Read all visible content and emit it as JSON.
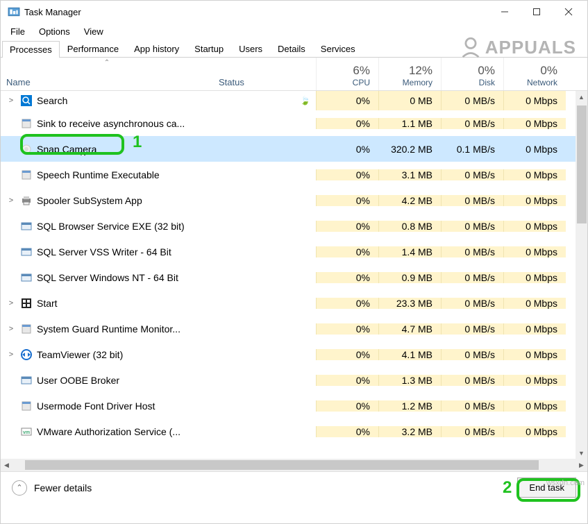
{
  "window": {
    "title": "Task Manager"
  },
  "menu": {
    "file": "File",
    "options": "Options",
    "view": "View"
  },
  "tabs": {
    "processes": "Processes",
    "performance": "Performance",
    "apphistory": "App history",
    "startup": "Startup",
    "users": "Users",
    "details": "Details",
    "services": "Services"
  },
  "watermark": "APPUALS",
  "columns": {
    "name": "Name",
    "status": "Status",
    "cpu_pct": "6%",
    "cpu": "CPU",
    "mem_pct": "12%",
    "mem": "Memory",
    "disk_pct": "0%",
    "disk": "Disk",
    "net_pct": "0%",
    "net": "Network"
  },
  "rows": [
    {
      "expand": ">",
      "icon": "search",
      "name": "Search",
      "status": "leaf",
      "cpu": "0%",
      "mem": "0 MB",
      "disk": "0 MB/s",
      "net": "0 Mbps",
      "top": true
    },
    {
      "expand": "",
      "icon": "generic",
      "name": "Sink to receive asynchronous ca...",
      "status": "",
      "cpu": "0%",
      "mem": "1.1 MB",
      "disk": "0 MB/s",
      "net": "0 Mbps"
    },
    {
      "expand": "",
      "icon": "snap",
      "name": "Snap Camera",
      "status": "",
      "cpu": "0%",
      "mem": "320.2 MB",
      "disk": "0.1 MB/s",
      "net": "0 Mbps",
      "selected": true
    },
    {
      "expand": "",
      "icon": "generic",
      "name": "Speech Runtime Executable",
      "status": "",
      "cpu": "0%",
      "mem": "3.1 MB",
      "disk": "0 MB/s",
      "net": "0 Mbps"
    },
    {
      "expand": ">",
      "icon": "printer",
      "name": "Spooler SubSystem App",
      "status": "",
      "cpu": "0%",
      "mem": "4.2 MB",
      "disk": "0 MB/s",
      "net": "0 Mbps"
    },
    {
      "expand": "",
      "icon": "service",
      "name": "SQL Browser Service EXE (32 bit)",
      "status": "",
      "cpu": "0%",
      "mem": "0.8 MB",
      "disk": "0 MB/s",
      "net": "0 Mbps"
    },
    {
      "expand": "",
      "icon": "service",
      "name": "SQL Server VSS Writer - 64 Bit",
      "status": "",
      "cpu": "0%",
      "mem": "1.4 MB",
      "disk": "0 MB/s",
      "net": "0 Mbps"
    },
    {
      "expand": "",
      "icon": "service",
      "name": "SQL Server Windows NT - 64 Bit",
      "status": "",
      "cpu": "0%",
      "mem": "0.9 MB",
      "disk": "0 MB/s",
      "net": "0 Mbps"
    },
    {
      "expand": ">",
      "icon": "start",
      "name": "Start",
      "status": "",
      "cpu": "0%",
      "mem": "23.3 MB",
      "disk": "0 MB/s",
      "net": "0 Mbps"
    },
    {
      "expand": ">",
      "icon": "generic",
      "name": "System Guard Runtime Monitor...",
      "status": "",
      "cpu": "0%",
      "mem": "4.7 MB",
      "disk": "0 MB/s",
      "net": "0 Mbps"
    },
    {
      "expand": ">",
      "icon": "teamviewer",
      "name": "TeamViewer (32 bit)",
      "status": "",
      "cpu": "0%",
      "mem": "4.1 MB",
      "disk": "0 MB/s",
      "net": "0 Mbps"
    },
    {
      "expand": "",
      "icon": "service",
      "name": "User OOBE Broker",
      "status": "",
      "cpu": "0%",
      "mem": "1.3 MB",
      "disk": "0 MB/s",
      "net": "0 Mbps"
    },
    {
      "expand": "",
      "icon": "generic",
      "name": "Usermode Font Driver Host",
      "status": "",
      "cpu": "0%",
      "mem": "1.2 MB",
      "disk": "0 MB/s",
      "net": "0 Mbps"
    },
    {
      "expand": "",
      "icon": "vmware",
      "name": "VMware Authorization Service (...",
      "status": "",
      "cpu": "0%",
      "mem": "3.2 MB",
      "disk": "0 MB/s",
      "net": "0 Mbps"
    }
  ],
  "footer": {
    "fewer": "Fewer details",
    "endtask": "End task"
  },
  "annotations": {
    "one": "1",
    "two": "2"
  },
  "url_watermark": "wsxdn.com"
}
